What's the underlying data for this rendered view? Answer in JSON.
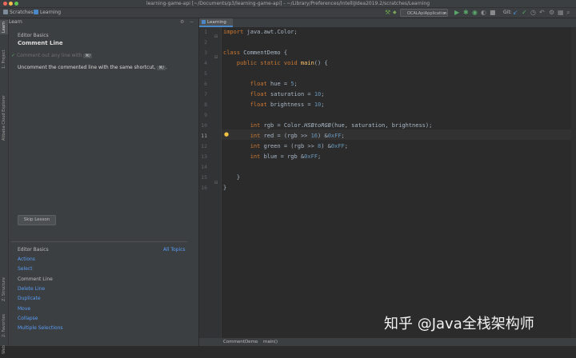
{
  "window": {
    "title": "learning-game-api [~/Documents/p3/learning-game-api] - ~/Library/Preferences/IntelliJIdea2019.2/scratches/Learning"
  },
  "navbar": {
    "breadcrumbs": [
      "Scratches",
      "Learning"
    ],
    "run_config": "OCALApiApplication",
    "git_label": "Git:"
  },
  "left_strip": {
    "labels": [
      "Learn",
      "1: Project",
      "Alibaba Cloud Explorer",
      "Z: Structure",
      "2: Favorites",
      "Web"
    ]
  },
  "learn_panel": {
    "header": "Learn",
    "module": "Editor Basics",
    "lesson_title": "Comment Line",
    "done_step": "Comment out any line with",
    "done_shortcut": "⌘/",
    "current_step": "Uncomment the commented line with the same shortcut,",
    "current_shortcut": "⌘/",
    "current_step_suffix": ".",
    "skip_button": "Skip Lesson",
    "bottom_module": "Editor Basics",
    "all_topics": "All Topics",
    "lessons": [
      {
        "label": "Actions",
        "link": true
      },
      {
        "label": "Select",
        "link": true
      },
      {
        "label": "Comment Line",
        "link": false
      },
      {
        "label": "Delete Line",
        "link": true
      },
      {
        "label": "Duplicate",
        "link": true
      },
      {
        "label": "Move",
        "link": true
      },
      {
        "label": "Collapse",
        "link": true
      },
      {
        "label": "Multiple Selections",
        "link": true
      }
    ]
  },
  "editor": {
    "tab": "Learning",
    "line_numbers": [
      "1",
      "2",
      "3",
      "4",
      "5",
      "6",
      "7",
      "8",
      "9",
      "10",
      "11",
      "12",
      "13",
      "14",
      "15",
      "16"
    ],
    "current_line": "11"
  },
  "status": {
    "breadcrumb1": "CommentDemo",
    "breadcrumb2": "main()"
  },
  "watermark": "知乎 @Java全栈架构师",
  "colors": {
    "keyword": "#cc7832",
    "number": "#6897bb",
    "method": "#ffc66d",
    "text": "#a9b7c6",
    "link": "#589df6",
    "background": "#2b2b2b"
  }
}
